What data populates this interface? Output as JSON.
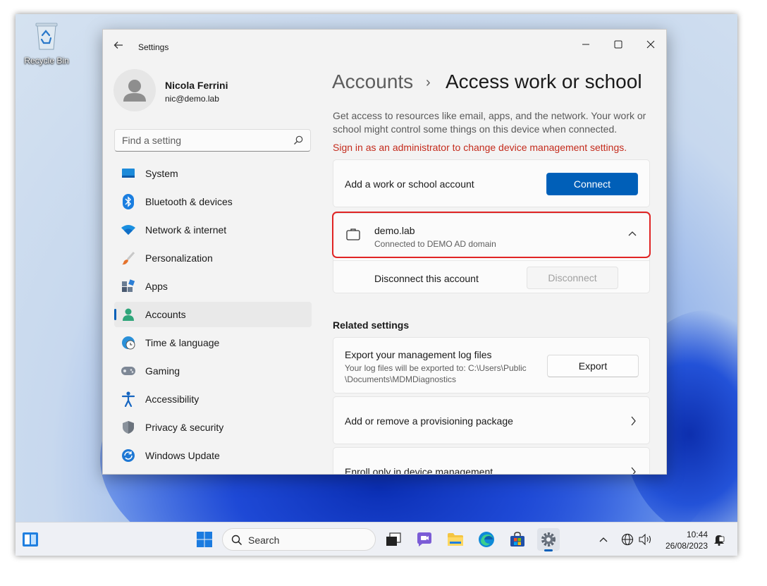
{
  "desktop": {
    "recycle_bin_label": "Recycle Bin"
  },
  "window": {
    "title": "Settings",
    "controls": {
      "minimize": "—",
      "maximize": "☐",
      "close": "✕"
    }
  },
  "profile": {
    "name": "Nicola Ferrini",
    "email": "nic@demo.lab"
  },
  "search": {
    "placeholder": "Find a setting"
  },
  "nav": {
    "items": [
      {
        "label": "System",
        "icon": "system-icon"
      },
      {
        "label": "Bluetooth & devices",
        "icon": "bluetooth-icon"
      },
      {
        "label": "Network & internet",
        "icon": "wifi-icon"
      },
      {
        "label": "Personalization",
        "icon": "brush-icon"
      },
      {
        "label": "Apps",
        "icon": "apps-icon"
      },
      {
        "label": "Accounts",
        "icon": "accounts-icon",
        "active": true
      },
      {
        "label": "Time & language",
        "icon": "globe-clock-icon"
      },
      {
        "label": "Gaming",
        "icon": "gamepad-icon"
      },
      {
        "label": "Accessibility",
        "icon": "accessibility-icon"
      },
      {
        "label": "Privacy & security",
        "icon": "shield-icon"
      },
      {
        "label": "Windows Update",
        "icon": "update-icon"
      }
    ]
  },
  "breadcrumb": {
    "parent": "Accounts",
    "separator": "›",
    "current": "Access work or school"
  },
  "main": {
    "description": "Get access to resources like email, apps, and the network. Your work or school might control some things on this device when connected.",
    "admin_warning": "Sign in as an administrator to change device management settings.",
    "add_account": {
      "label": "Add a work or school account",
      "button": "Connect"
    },
    "account": {
      "name": "demo.lab",
      "status": "Connected to DEMO AD domain",
      "disconnect_label": "Disconnect this account",
      "disconnect_button": "Disconnect"
    },
    "related_heading": "Related settings",
    "export": {
      "title": "Export your management log files",
      "subtitle_line1": "Your log files will be exported to: C:\\Users\\Public",
      "subtitle_line2": "\\Documents\\MDMDiagnostics",
      "button": "Export"
    },
    "provisioning": {
      "label": "Add or remove a provisioning package"
    },
    "enroll": {
      "label": "Enroll only in device management"
    }
  },
  "taskbar": {
    "search_label": "Search",
    "time": "10:44",
    "date": "26/08/2023"
  },
  "colors": {
    "accent": "#005fb8",
    "warning": "#c42b1c",
    "highlight_box": "#e02424"
  }
}
